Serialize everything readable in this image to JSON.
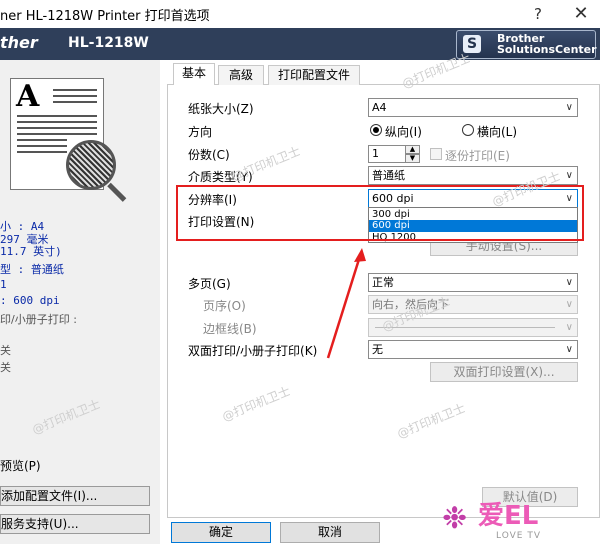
{
  "window": {
    "title": "ner HL-1218W Printer 打印首选项",
    "help_glyph": "?",
    "close_glyph": "✕"
  },
  "header": {
    "brand": "ther",
    "model": "HL-1218W",
    "solutions_line1": "Brother",
    "solutions_line2": "SolutionsCenter",
    "solutions_icon": "S"
  },
  "left_panel": {
    "preview_letter": "A",
    "summary": {
      "paper_size": "小 : A4",
      "paper_mm": "297 毫米",
      "paper_inch": "11.7 英寸)",
      "media_type": "型 : 普通纸",
      "copies": "1",
      "resolution": ": 600 dpi",
      "duplex": "印/小册子打印 :",
      "off1": "关",
      "off2": "关"
    },
    "preview_label": "预览(P)",
    "add_profile_button": "添加配置文件(I)...",
    "support_button": "服务支持(U)..."
  },
  "tabs": [
    {
      "label": "基本",
      "active": true
    },
    {
      "label": "高级",
      "active": false
    },
    {
      "label": "打印配置文件",
      "active": false
    }
  ],
  "form": {
    "paper_size_label": "纸张大小(Z)",
    "paper_size_value": "A4",
    "orientation_label": "方向",
    "portrait_label": "纵向(I)",
    "landscape_label": "横向(L)",
    "copies_label": "份数(C)",
    "copies_value": "1",
    "collate_label": "逐份打印(E)",
    "media_label": "介质类型(Y)",
    "media_value": "普通纸",
    "resolution_label": "分辨率(I)",
    "resolution_value": "600 dpi",
    "resolution_options": [
      "300 dpi",
      "600 dpi",
      "HQ 1200"
    ],
    "resolution_selected_index": 1,
    "print_settings_label": "打印设置(N)",
    "manual_settings_button": "手动设置(S)...",
    "multi_page_label": "多页(G)",
    "multi_page_value": "正常",
    "page_order_label": "页序(O)",
    "page_order_value": "向右，然后向下",
    "border_label": "边框线(B)",
    "duplex_label": "双面打印/小册子打印(K)",
    "duplex_value": "无",
    "duplex_settings_button": "双面打印设置(X)...",
    "default_button": "默认值(D)"
  },
  "footer": {
    "ok_button": "确定",
    "cancel_button": "取消"
  },
  "watermark": {
    "text": "@打印机卫士",
    "logo_text": "爱EL",
    "logo_sub": "LOVE TV",
    "logo_glyph": "❉"
  },
  "annotation_color": "#e41e1e"
}
